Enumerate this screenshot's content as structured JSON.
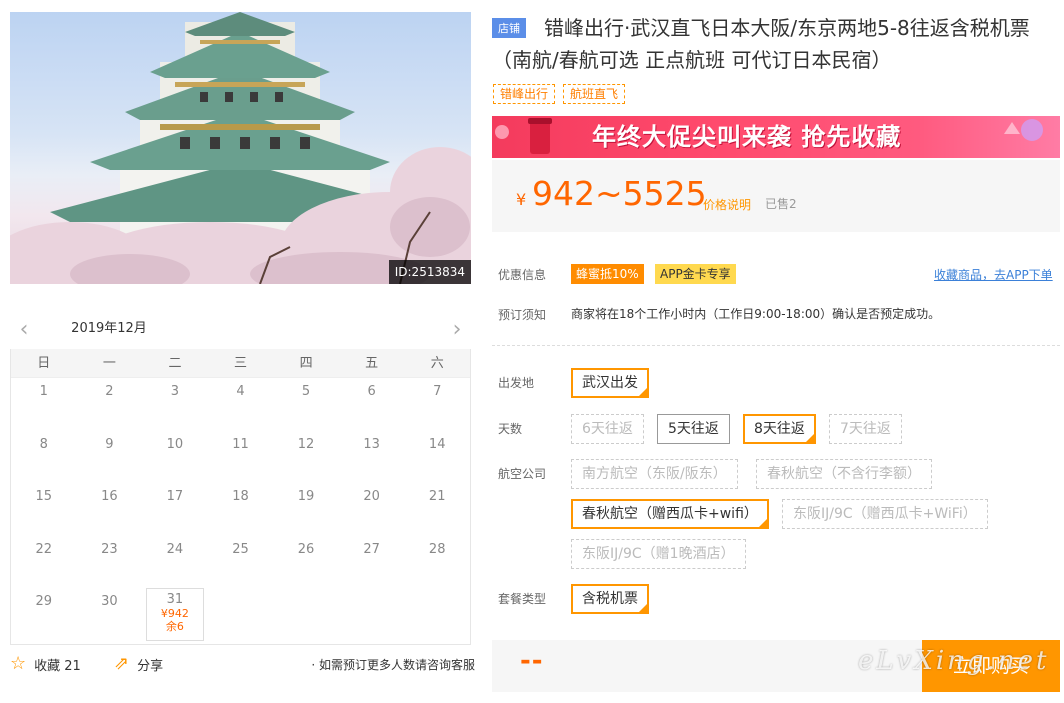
{
  "product": {
    "photo_id": "ID:2513834",
    "shop_tag": "店铺",
    "title": "错峰出行·武汉直飞日本大阪/东京两地5-8往返含税机票（南航/春航可选 正点航班 可代订日本民宿）",
    "tags": [
      "错峰出行",
      "航班直飞"
    ],
    "banner": "年终大促尖叫来袭  抢先收藏",
    "price_symbol": "¥",
    "price_range": "942~5525",
    "price_note": "价格说明",
    "sold": "已售2"
  },
  "calendar": {
    "month": "2019年12月",
    "weekdays": [
      "日",
      "一",
      "二",
      "三",
      "四",
      "五",
      "六"
    ],
    "days": [
      "1",
      "2",
      "3",
      "4",
      "5",
      "6",
      "7",
      "8",
      "9",
      "10",
      "11",
      "12",
      "13",
      "14",
      "15",
      "16",
      "17",
      "18",
      "19",
      "20",
      "21",
      "22",
      "23",
      "24",
      "25",
      "26",
      "27",
      "28",
      "29",
      "30",
      "31"
    ],
    "available": {
      "day": "31",
      "price": "¥942",
      "stock": "余6"
    }
  },
  "actions": {
    "favorite": "收藏 21",
    "share": "分享",
    "note": "· 如需预订更多人数请咨询客服"
  },
  "info": {
    "promo_label": "优惠信息",
    "promo1": "蜂蜜抵10%",
    "promo2": "APP金卡专享",
    "fav_link": "收藏商品，去APP下单",
    "notice_label": "预订须知",
    "notice": "商家将在18个工作小时内（工作日9:00-18:00）确认是否预定成功。"
  },
  "options": {
    "departure_label": "出发地",
    "departure": [
      "武汉出发"
    ],
    "days_label": "天数",
    "days": [
      "6天往返",
      "5天往返",
      "8天往返",
      "7天往返"
    ],
    "airline_label": "航空公司",
    "airlines": [
      "南方航空（东阪/阪东）",
      "春秋航空（不含行李额）",
      "春秋航空（赠西瓜卡+wifi）",
      "东阪IJ/9C（赠西瓜卡+WiFi）",
      "东阪IJ/9C（赠1晚酒店）"
    ],
    "package_label": "套餐类型",
    "packages": [
      "含税机票"
    ]
  },
  "buy": {
    "price": "--",
    "button": "立即购买",
    "watermark": "eLvXing.net"
  },
  "colors": {
    "accent": "#ff9600",
    "price": "#ff6600",
    "link": "#3b80d8",
    "shop_tag": "#5b8ee8"
  }
}
